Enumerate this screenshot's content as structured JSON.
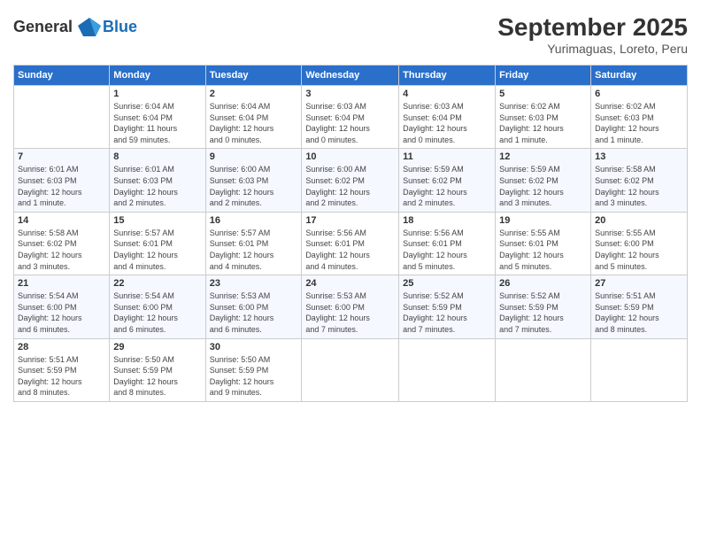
{
  "header": {
    "logo_general": "General",
    "logo_blue": "Blue",
    "month": "September 2025",
    "location": "Yurimaguas, Loreto, Peru"
  },
  "days_of_week": [
    "Sunday",
    "Monday",
    "Tuesday",
    "Wednesday",
    "Thursday",
    "Friday",
    "Saturday"
  ],
  "weeks": [
    [
      {
        "day": "",
        "info": ""
      },
      {
        "day": "1",
        "info": "Sunrise: 6:04 AM\nSunset: 6:04 PM\nDaylight: 11 hours\nand 59 minutes."
      },
      {
        "day": "2",
        "info": "Sunrise: 6:04 AM\nSunset: 6:04 PM\nDaylight: 12 hours\nand 0 minutes."
      },
      {
        "day": "3",
        "info": "Sunrise: 6:03 AM\nSunset: 6:04 PM\nDaylight: 12 hours\nand 0 minutes."
      },
      {
        "day": "4",
        "info": "Sunrise: 6:03 AM\nSunset: 6:04 PM\nDaylight: 12 hours\nand 0 minutes."
      },
      {
        "day": "5",
        "info": "Sunrise: 6:02 AM\nSunset: 6:03 PM\nDaylight: 12 hours\nand 1 minute."
      },
      {
        "day": "6",
        "info": "Sunrise: 6:02 AM\nSunset: 6:03 PM\nDaylight: 12 hours\nand 1 minute."
      }
    ],
    [
      {
        "day": "7",
        "info": "Sunrise: 6:01 AM\nSunset: 6:03 PM\nDaylight: 12 hours\nand 1 minute."
      },
      {
        "day": "8",
        "info": "Sunrise: 6:01 AM\nSunset: 6:03 PM\nDaylight: 12 hours\nand 2 minutes."
      },
      {
        "day": "9",
        "info": "Sunrise: 6:00 AM\nSunset: 6:03 PM\nDaylight: 12 hours\nand 2 minutes."
      },
      {
        "day": "10",
        "info": "Sunrise: 6:00 AM\nSunset: 6:02 PM\nDaylight: 12 hours\nand 2 minutes."
      },
      {
        "day": "11",
        "info": "Sunrise: 5:59 AM\nSunset: 6:02 PM\nDaylight: 12 hours\nand 2 minutes."
      },
      {
        "day": "12",
        "info": "Sunrise: 5:59 AM\nSunset: 6:02 PM\nDaylight: 12 hours\nand 3 minutes."
      },
      {
        "day": "13",
        "info": "Sunrise: 5:58 AM\nSunset: 6:02 PM\nDaylight: 12 hours\nand 3 minutes."
      }
    ],
    [
      {
        "day": "14",
        "info": "Sunrise: 5:58 AM\nSunset: 6:02 PM\nDaylight: 12 hours\nand 3 minutes."
      },
      {
        "day": "15",
        "info": "Sunrise: 5:57 AM\nSunset: 6:01 PM\nDaylight: 12 hours\nand 4 minutes."
      },
      {
        "day": "16",
        "info": "Sunrise: 5:57 AM\nSunset: 6:01 PM\nDaylight: 12 hours\nand 4 minutes."
      },
      {
        "day": "17",
        "info": "Sunrise: 5:56 AM\nSunset: 6:01 PM\nDaylight: 12 hours\nand 4 minutes."
      },
      {
        "day": "18",
        "info": "Sunrise: 5:56 AM\nSunset: 6:01 PM\nDaylight: 12 hours\nand 5 minutes."
      },
      {
        "day": "19",
        "info": "Sunrise: 5:55 AM\nSunset: 6:01 PM\nDaylight: 12 hours\nand 5 minutes."
      },
      {
        "day": "20",
        "info": "Sunrise: 5:55 AM\nSunset: 6:00 PM\nDaylight: 12 hours\nand 5 minutes."
      }
    ],
    [
      {
        "day": "21",
        "info": "Sunrise: 5:54 AM\nSunset: 6:00 PM\nDaylight: 12 hours\nand 6 minutes."
      },
      {
        "day": "22",
        "info": "Sunrise: 5:54 AM\nSunset: 6:00 PM\nDaylight: 12 hours\nand 6 minutes."
      },
      {
        "day": "23",
        "info": "Sunrise: 5:53 AM\nSunset: 6:00 PM\nDaylight: 12 hours\nand 6 minutes."
      },
      {
        "day": "24",
        "info": "Sunrise: 5:53 AM\nSunset: 6:00 PM\nDaylight: 12 hours\nand 7 minutes."
      },
      {
        "day": "25",
        "info": "Sunrise: 5:52 AM\nSunset: 5:59 PM\nDaylight: 12 hours\nand 7 minutes."
      },
      {
        "day": "26",
        "info": "Sunrise: 5:52 AM\nSunset: 5:59 PM\nDaylight: 12 hours\nand 7 minutes."
      },
      {
        "day": "27",
        "info": "Sunrise: 5:51 AM\nSunset: 5:59 PM\nDaylight: 12 hours\nand 8 minutes."
      }
    ],
    [
      {
        "day": "28",
        "info": "Sunrise: 5:51 AM\nSunset: 5:59 PM\nDaylight: 12 hours\nand 8 minutes."
      },
      {
        "day": "29",
        "info": "Sunrise: 5:50 AM\nSunset: 5:59 PM\nDaylight: 12 hours\nand 8 minutes."
      },
      {
        "day": "30",
        "info": "Sunrise: 5:50 AM\nSunset: 5:59 PM\nDaylight: 12 hours\nand 9 minutes."
      },
      {
        "day": "",
        "info": ""
      },
      {
        "day": "",
        "info": ""
      },
      {
        "day": "",
        "info": ""
      },
      {
        "day": "",
        "info": ""
      }
    ]
  ]
}
